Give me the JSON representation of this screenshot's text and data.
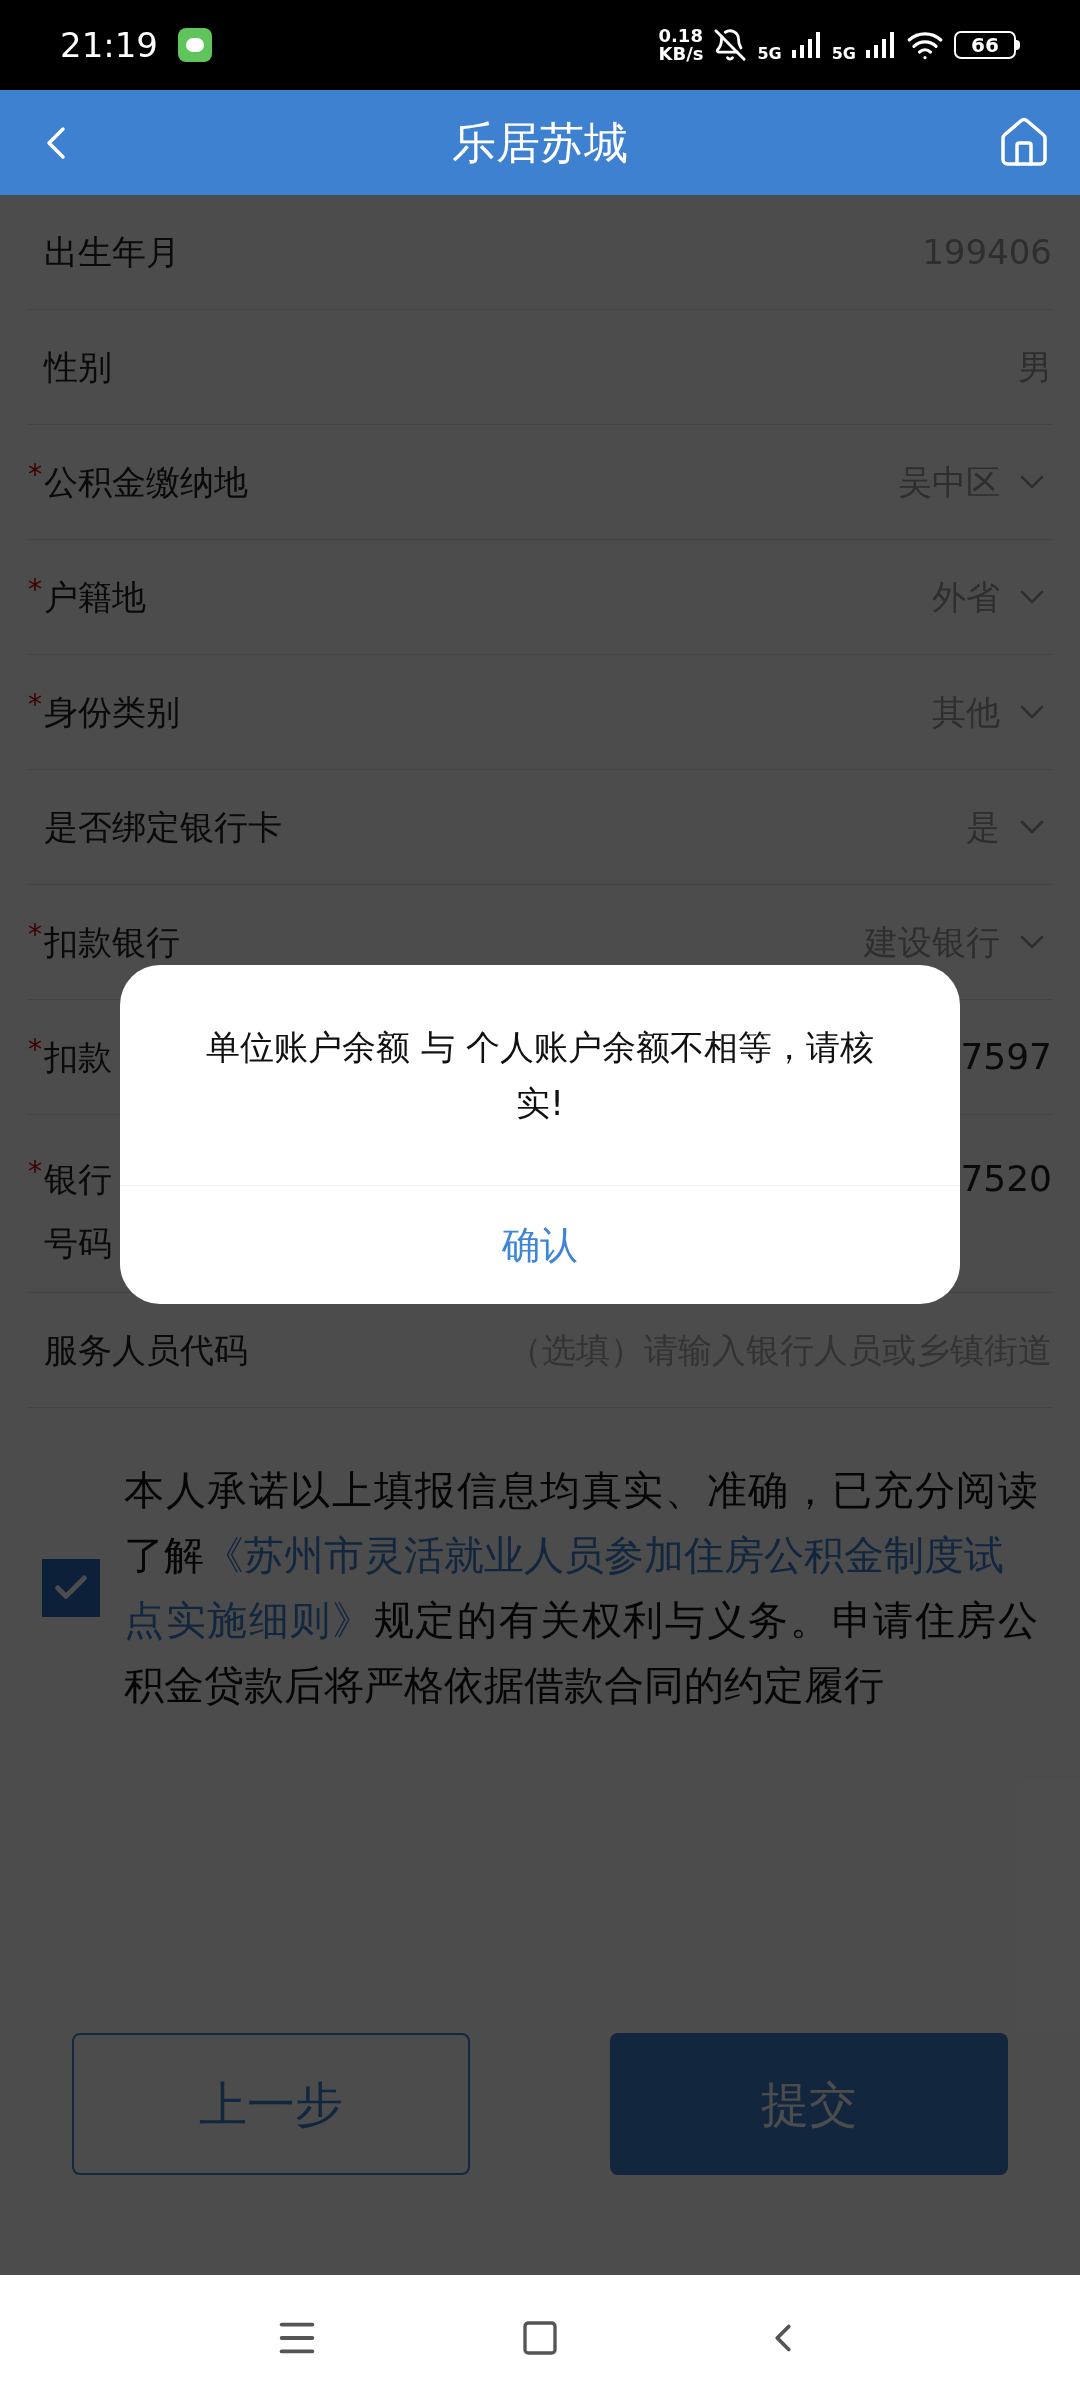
{
  "status_bar": {
    "time": "21:19",
    "speed_value": "0.18",
    "speed_unit": "KB/s",
    "network_1": "5G",
    "network_2": "5G",
    "battery": "66"
  },
  "header": {
    "title": "乐居苏城"
  },
  "form": {
    "rows": [
      {
        "kind": "static",
        "label": "出生年月",
        "value": "199406"
      },
      {
        "kind": "static",
        "label": "性别",
        "value": "男"
      },
      {
        "kind": "select",
        "marker": "*",
        "label": "公积金缴纳地",
        "value": "吴中区"
      },
      {
        "kind": "select",
        "marker": "*",
        "label": "户籍地",
        "value": "外省"
      },
      {
        "kind": "select",
        "marker": "*",
        "label": "身份类别",
        "value": "其他"
      },
      {
        "kind": "select",
        "label": "是否绑定银行卡",
        "value": "是"
      },
      {
        "kind": "select",
        "marker": "*",
        "label": "扣款银行",
        "value": "建设银行"
      },
      {
        "kind": "input",
        "marker": "*",
        "label": "扣款",
        "value": "7597"
      },
      {
        "kind": "input",
        "marker": "*",
        "label": "银行",
        "label_line_2": "号码",
        "value": "7520"
      },
      {
        "kind": "placeholder",
        "label": "服务人员代码",
        "placeholder": "（选填）请输入银行人员或乡镇街道"
      }
    ]
  },
  "agreement": {
    "checked": true,
    "text_before": "本人承诺以上填报信息均真实、准确，已充分阅读了解",
    "link_line_1": "《苏州市灵活就业人员参加住房公积金制度试",
    "link_line_2": "点实施细则》",
    "text_after": "规定的有关权利与义务。申请住房公积金贷款后将严格依据借款合同的约定履行"
  },
  "buttons": [
    {
      "kind": "outline",
      "label": "上一步"
    },
    {
      "kind": "primary",
      "label": "提交"
    }
  ],
  "dialog": {
    "message": "单位账户余额 与 个人账户余额不相等，请核实!",
    "confirm": "确认"
  }
}
